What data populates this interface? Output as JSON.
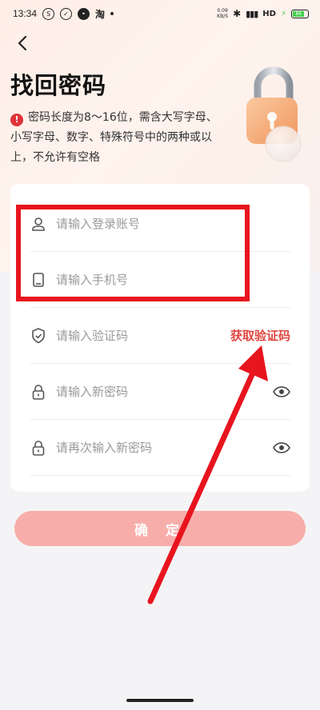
{
  "status_bar": {
    "time": "13:34",
    "network_speed_value": "0.09",
    "network_speed_unit": "KB/S",
    "network_type": "HD",
    "battery_level": "86"
  },
  "page": {
    "title": "找回密码",
    "hint": "密码长度为8～16位，需含大写字母、小写字母、数字、特殊符号中的两种或以上，不允许有空格"
  },
  "form": {
    "fields": [
      {
        "placeholder": "请输入登录账号",
        "icon": "user-icon"
      },
      {
        "placeholder": "请输入手机号",
        "icon": "phone-icon"
      },
      {
        "placeholder": "请输入验证码",
        "icon": "shield-icon",
        "action": "获取验证码"
      },
      {
        "placeholder": "请输入新密码",
        "icon": "lock-icon",
        "toggle": "eye-icon"
      },
      {
        "placeholder": "请再次输入新密码",
        "icon": "lock-icon",
        "toggle": "eye-icon"
      }
    ],
    "confirm_label": "确 定"
  },
  "colors": {
    "accent": "#e0463f",
    "button_disabled": "#f7aeaa",
    "annotation": "#e8141e"
  }
}
